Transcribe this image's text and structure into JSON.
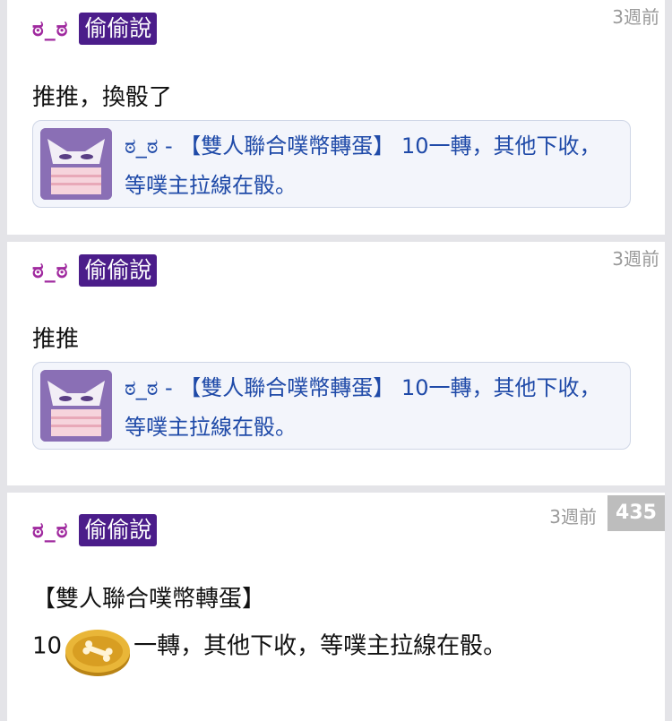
{
  "posts": [
    {
      "nickname": "ಠ_ಠ",
      "tag": "偷偷說",
      "time": "3週前",
      "body": "推推，換骰了",
      "quote": {
        "text": "ಠ_ಠ - 【雙人聯合噗幣轉蛋】 10一轉，其他下收，等噗主拉線在骰。"
      }
    },
    {
      "nickname": "ಠ_ಠ",
      "tag": "偷偷說",
      "time": "3週前",
      "body": "推推",
      "quote": {
        "text": "ಠ_ಠ - 【雙人聯合噗幣轉蛋】 10一轉，其他下收，等噗主拉線在骰。"
      }
    },
    {
      "nickname": "ಠ_ಠ",
      "tag": "偷偷說",
      "time": "3週前",
      "floor": "435",
      "title_line": "【雙人聯合噗幣轉蛋】",
      "line2_prefix": "10",
      "line2_suffix": "一轉，其他下收，等噗主拉線在骰。"
    }
  ],
  "colors": {
    "nickname": "#a02a9f",
    "tag_bg": "#4b1d8a",
    "quote_text": "#1f4aa8",
    "timestamp": "#9a9a9a",
    "floor_bg": "#bdbdbd"
  },
  "icons": {
    "quote_thumb": "masked-avatar-icon",
    "coin": "plurk-coin-icon"
  }
}
